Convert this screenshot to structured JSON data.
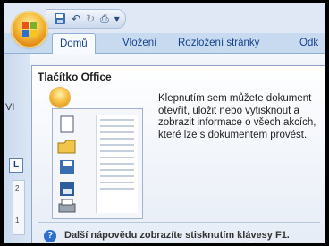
{
  "qat": {
    "save_icon": "save-icon",
    "undo_glyph": "↶",
    "redo_glyph": "↻",
    "print_glyph": "⎙",
    "customize_glyph": "▾"
  },
  "tabs": [
    {
      "label": "Domů",
      "active": true
    },
    {
      "label": "Vložení",
      "active": false
    },
    {
      "label": "Rozložení stránky",
      "active": false
    },
    {
      "label": "Odk",
      "active": false
    }
  ],
  "left": {
    "vi_text": "VI",
    "ruler_button": "L",
    "ruler_num_a": "2",
    "ruler_num_b": "1"
  },
  "tooltip": {
    "title": "Tlačítko Office",
    "description": "Klepnutím sem můžete dokument otevřít, uložit nebo vytisknout a zobrazit informace o všech akcích, které lze s dokumentem provést.",
    "help_text": "Další nápovědu zobrazíte stisknutím klávesy F1.",
    "help_glyph": "?"
  },
  "colors": {
    "ribbon_text": "#15428b",
    "orb": "#f7c243",
    "help_icon": "#2c6fcf"
  }
}
